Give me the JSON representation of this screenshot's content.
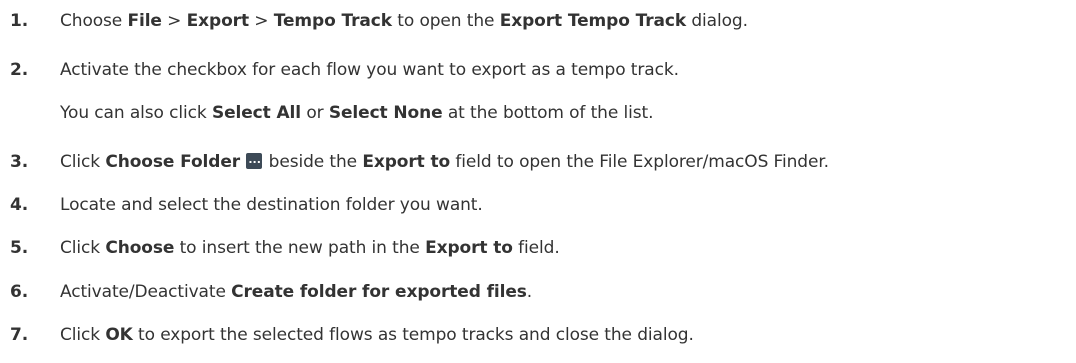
{
  "steps": [
    {
      "num": "1.",
      "parts": [
        {
          "t": "Choose "
        },
        {
          "t": "File",
          "b": true
        },
        {
          "t": " > "
        },
        {
          "t": "Export",
          "b": true
        },
        {
          "t": " > "
        },
        {
          "t": "Tempo Track",
          "b": true
        },
        {
          "t": " to open the "
        },
        {
          "t": "Export Tempo Track",
          "b": true
        },
        {
          "t": " dialog."
        }
      ]
    },
    {
      "num": "2.",
      "parts": [
        {
          "t": "Activate the checkbox for each flow you want to export as a tempo track."
        }
      ],
      "continuation": [
        {
          "t": "You can also click "
        },
        {
          "t": "Select All",
          "b": true
        },
        {
          "t": " or "
        },
        {
          "t": "Select None",
          "b": true
        },
        {
          "t": " at the bottom of the list."
        }
      ]
    },
    {
      "num": "3.",
      "parts": [
        {
          "t": "Click "
        },
        {
          "t": "Choose Folder",
          "b": true
        },
        {
          "t": " "
        },
        {
          "icon": "ellipsis-button-icon"
        },
        {
          "t": " beside the "
        },
        {
          "t": "Export to",
          "b": true
        },
        {
          "t": " field to open the File Explorer/macOS Finder."
        }
      ]
    },
    {
      "num": "4.",
      "parts": [
        {
          "t": "Locate and select the destination folder you want."
        }
      ]
    },
    {
      "num": "5.",
      "parts": [
        {
          "t": "Click "
        },
        {
          "t": "Choose",
          "b": true
        },
        {
          "t": " to insert the new path in the "
        },
        {
          "t": "Export to",
          "b": true
        },
        {
          "t": " field."
        }
      ]
    },
    {
      "num": "6.",
      "parts": [
        {
          "t": "Activate/Deactivate "
        },
        {
          "t": "Create folder for exported files",
          "b": true
        },
        {
          "t": "."
        }
      ]
    },
    {
      "num": "7.",
      "parts": [
        {
          "t": "Click "
        },
        {
          "t": "OK",
          "b": true
        },
        {
          "t": " to export the selected flows as tempo tracks and close the dialog."
        }
      ]
    }
  ]
}
